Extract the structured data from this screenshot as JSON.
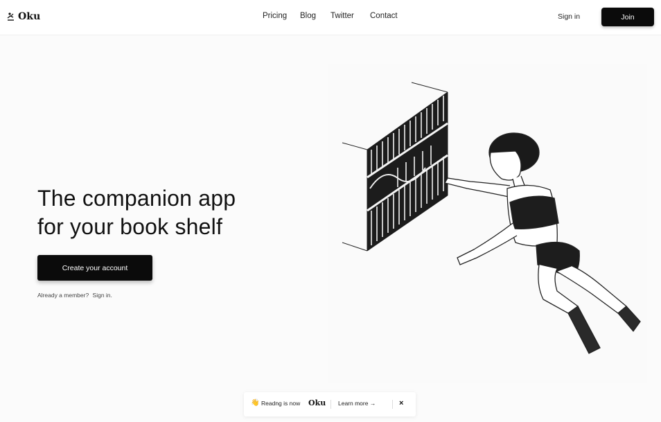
{
  "header": {
    "brand": "Oku",
    "logo_icon": "reading-figure-icon",
    "nav": [
      {
        "label": "Pricing"
      },
      {
        "label": "Blog"
      },
      {
        "label": "Twitter"
      },
      {
        "label": "Contact"
      }
    ],
    "signin_label": "Sign in",
    "join_label": "Join"
  },
  "hero": {
    "title_line1": "The companion app",
    "title_line2": "for your book shelf",
    "cta_label": "Create your account",
    "member_text": "Already a member?",
    "member_link": "Sign in.",
    "illustration_icon": "woman-reaching-bookshelf-illustration"
  },
  "toast": {
    "emoji": "👋",
    "message": "Readng is now",
    "brand": "Oku",
    "learn_label": "Learn more →",
    "close_label": "×"
  },
  "colors": {
    "background": "#fbfbfb",
    "header_bg": "#ffffff",
    "button_bg": "#0b0b0b",
    "button_text": "#ffffff",
    "text": "#111111"
  }
}
